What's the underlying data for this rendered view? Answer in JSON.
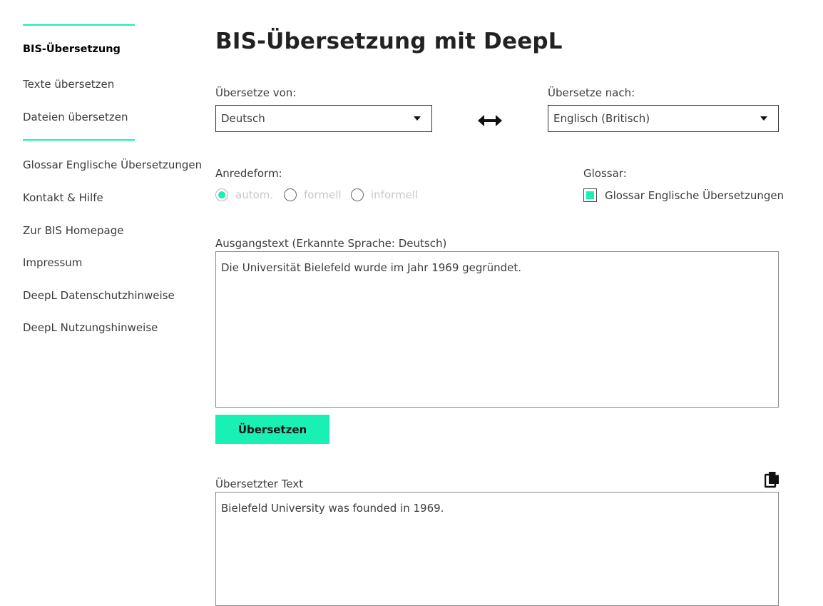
{
  "sidebar": {
    "items": [
      {
        "label": "BIS-Übersetzung"
      },
      {
        "label": "Texte übersetzen"
      },
      {
        "label": "Dateien übersetzen"
      },
      {
        "label": "Glossar Englische Übersetzungen"
      },
      {
        "label": "Kontakt & Hilfe"
      },
      {
        "label": "Zur BIS Homepage"
      },
      {
        "label": "Impressum"
      },
      {
        "label": "DeepL Datenschutzhinweise"
      },
      {
        "label": "DeepL Nutzungshinweise"
      }
    ]
  },
  "main": {
    "title": "BIS-Übersetzung mit DeepL",
    "source_lang": {
      "label": "Übersetze von:",
      "value": "Deutsch"
    },
    "target_lang": {
      "label": "Übersetze nach:",
      "value": "Englisch (Britisch)"
    },
    "formality": {
      "label": "Anredeform:",
      "options": [
        "autom.",
        "formell",
        "informell"
      ],
      "selected": "autom."
    },
    "glossary": {
      "label": "Glossar:",
      "option": "Glossar Englische Übersetzungen",
      "checked": true
    },
    "source_text": {
      "label": "Ausgangstext (Erkannte Sprache: Deutsch)",
      "value": "Die Universität Bielefeld wurde im Jahr 1969 gegründet."
    },
    "translate_button": "Übersetzen",
    "translated_text": {
      "label": "Übersetzter Text",
      "value": "Bielefeld University was founded in 1969."
    }
  },
  "colors": {
    "accent": "#19f0b4",
    "text": "#3c3c3c",
    "title": "#222222"
  },
  "icons": {
    "swap": "swap-arrows-icon",
    "copy": "copy-icon",
    "caret": "chevron-down-icon"
  }
}
